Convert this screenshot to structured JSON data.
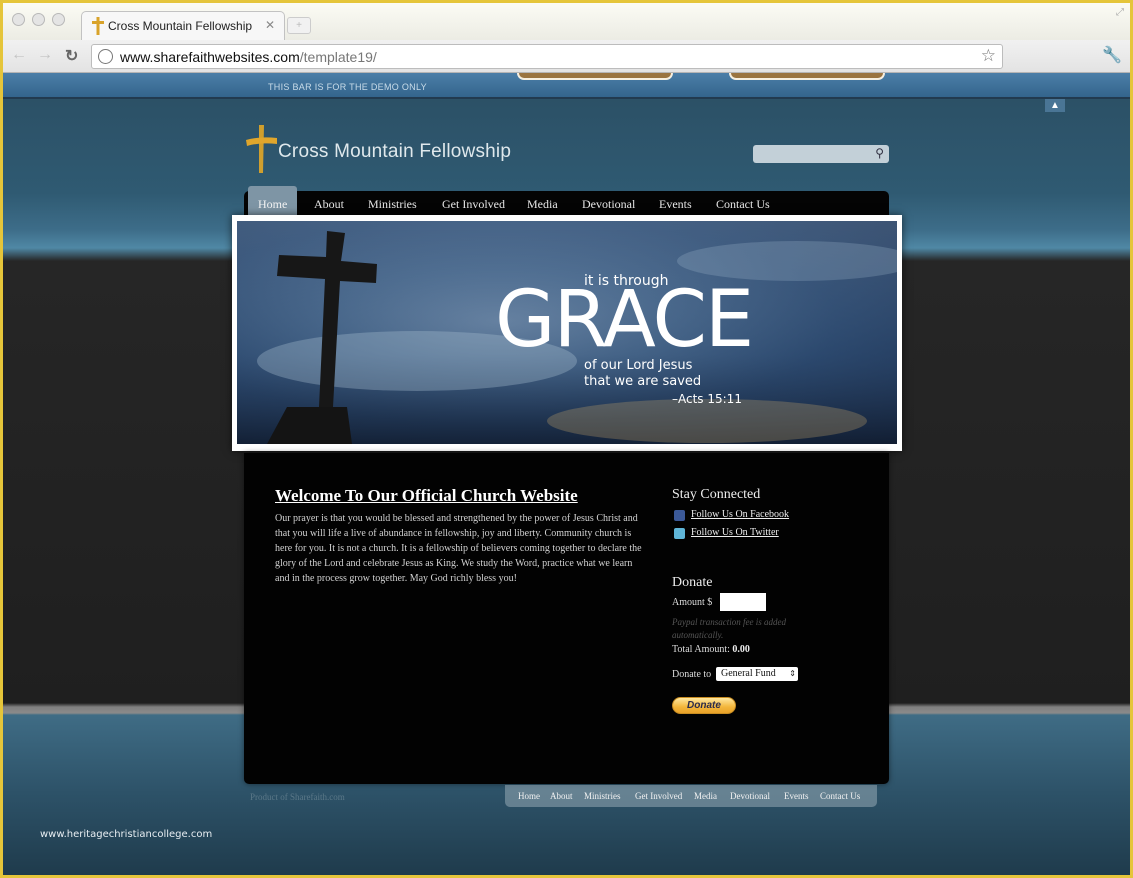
{
  "browser": {
    "tab_title": "Cross Mountain Fellowship",
    "url_domain": "www.sharefaithwebsites.com",
    "url_path": "/template19/"
  },
  "demo_bar": {
    "text": "THIS BAR IS FOR THE DEMO ONLY"
  },
  "site": {
    "title": "Cross Mountain Fellowship",
    "search_placeholder": ""
  },
  "nav": {
    "items": [
      "Home",
      "About",
      "Ministries",
      "Get Involved",
      "Media",
      "Devotional",
      "Events",
      "Contact Us"
    ],
    "active": "Home"
  },
  "banner": {
    "line1": "it is through",
    "headline": "GRACE",
    "line2": "of our Lord Jesus",
    "line3": "that we are saved",
    "reference": "–Acts 15:11",
    "slide_count": 2,
    "active_slide": 1
  },
  "welcome": {
    "heading": "Welcome To Our Official Church Website",
    "body": "Our prayer is that you would be blessed and strengthened by the power of Jesus Christ and that you will life a live of abundance in fellowship, joy and liberty. Community church is here for you. It is not a church. It is a fellowship of believers coming together to declare the glory of the Lord and celebrate Jesus as King. We study the Word, practice what we learn and in the process grow together. May God richly bless you!"
  },
  "stay_connected": {
    "heading": "Stay Connected",
    "facebook": "Follow Us On Facebook",
    "twitter": "Follow Us On Twitter",
    "facebook_color": "#3b5998",
    "twitter_color": "#5fb5d8"
  },
  "donate": {
    "heading": "Donate",
    "amount_label": "Amount $",
    "amount_value": "",
    "fee_note": "Paypal transaction fee is added automatically.",
    "total_label": "Total Amount:",
    "total_value": "0.00",
    "donate_to_label": "Donate to",
    "fund_selected": "General Fund",
    "button_label": "Donate"
  },
  "footer": {
    "product_of": "Product of Sharefaith.com",
    "links": [
      "Home",
      "About",
      "Ministries",
      "Get Involved",
      "Media",
      "Devotional",
      "Events",
      "Contact Us"
    ]
  },
  "watermark": "www.heritagechristiancollege.com",
  "colors": {
    "logo_gold": "#d9a32a",
    "nav_active": "#7e95a5",
    "demo_bar": "#3d6f98"
  }
}
